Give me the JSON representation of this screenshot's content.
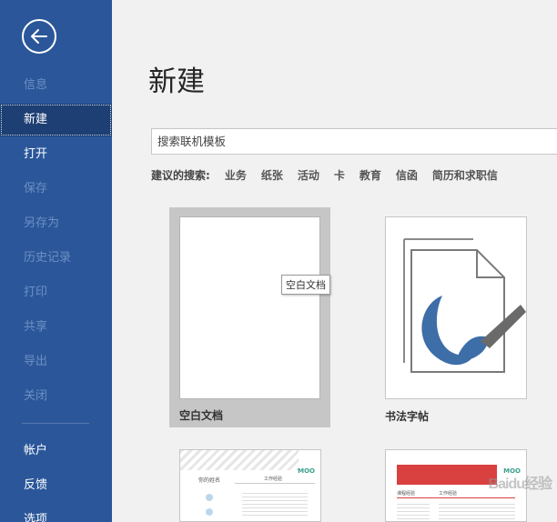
{
  "sidebar": {
    "items": [
      {
        "label": "信息",
        "state": "disabled"
      },
      {
        "label": "新建",
        "state": "active"
      },
      {
        "label": "打开",
        "state": "normal"
      },
      {
        "label": "保存",
        "state": "disabled"
      },
      {
        "label": "另存为",
        "state": "disabled"
      },
      {
        "label": "历史记录",
        "state": "disabled"
      },
      {
        "label": "打印",
        "state": "disabled"
      },
      {
        "label": "共享",
        "state": "disabled"
      },
      {
        "label": "导出",
        "state": "disabled"
      },
      {
        "label": "关闭",
        "state": "disabled"
      },
      {
        "label": "帐户",
        "state": "normal"
      },
      {
        "label": "反馈",
        "state": "normal"
      },
      {
        "label": "选项",
        "state": "normal"
      }
    ]
  },
  "main": {
    "title": "新建",
    "search_text": "搜索联机模板",
    "suggested_label": "建议的搜索:",
    "suggested_tags": [
      "业务",
      "纸张",
      "活动",
      "卡",
      "教育",
      "信函",
      "简历和求职信"
    ]
  },
  "templates": [
    {
      "name": "空白文档",
      "tooltip": "空白文档"
    },
    {
      "name": "书法字帖"
    },
    {
      "name": "",
      "brand": "MOO",
      "heading": "你的姓名",
      "section": "工作经验"
    },
    {
      "name": "",
      "brand": "MOO",
      "section": "课程经验",
      "section2": "工作经验"
    }
  ],
  "watermark": "Baidu经验",
  "colors": {
    "sidebar": "#2b579a",
    "active": "#1e3f73",
    "accent_green": "#3aa18a",
    "accent_red": "#d94040"
  }
}
